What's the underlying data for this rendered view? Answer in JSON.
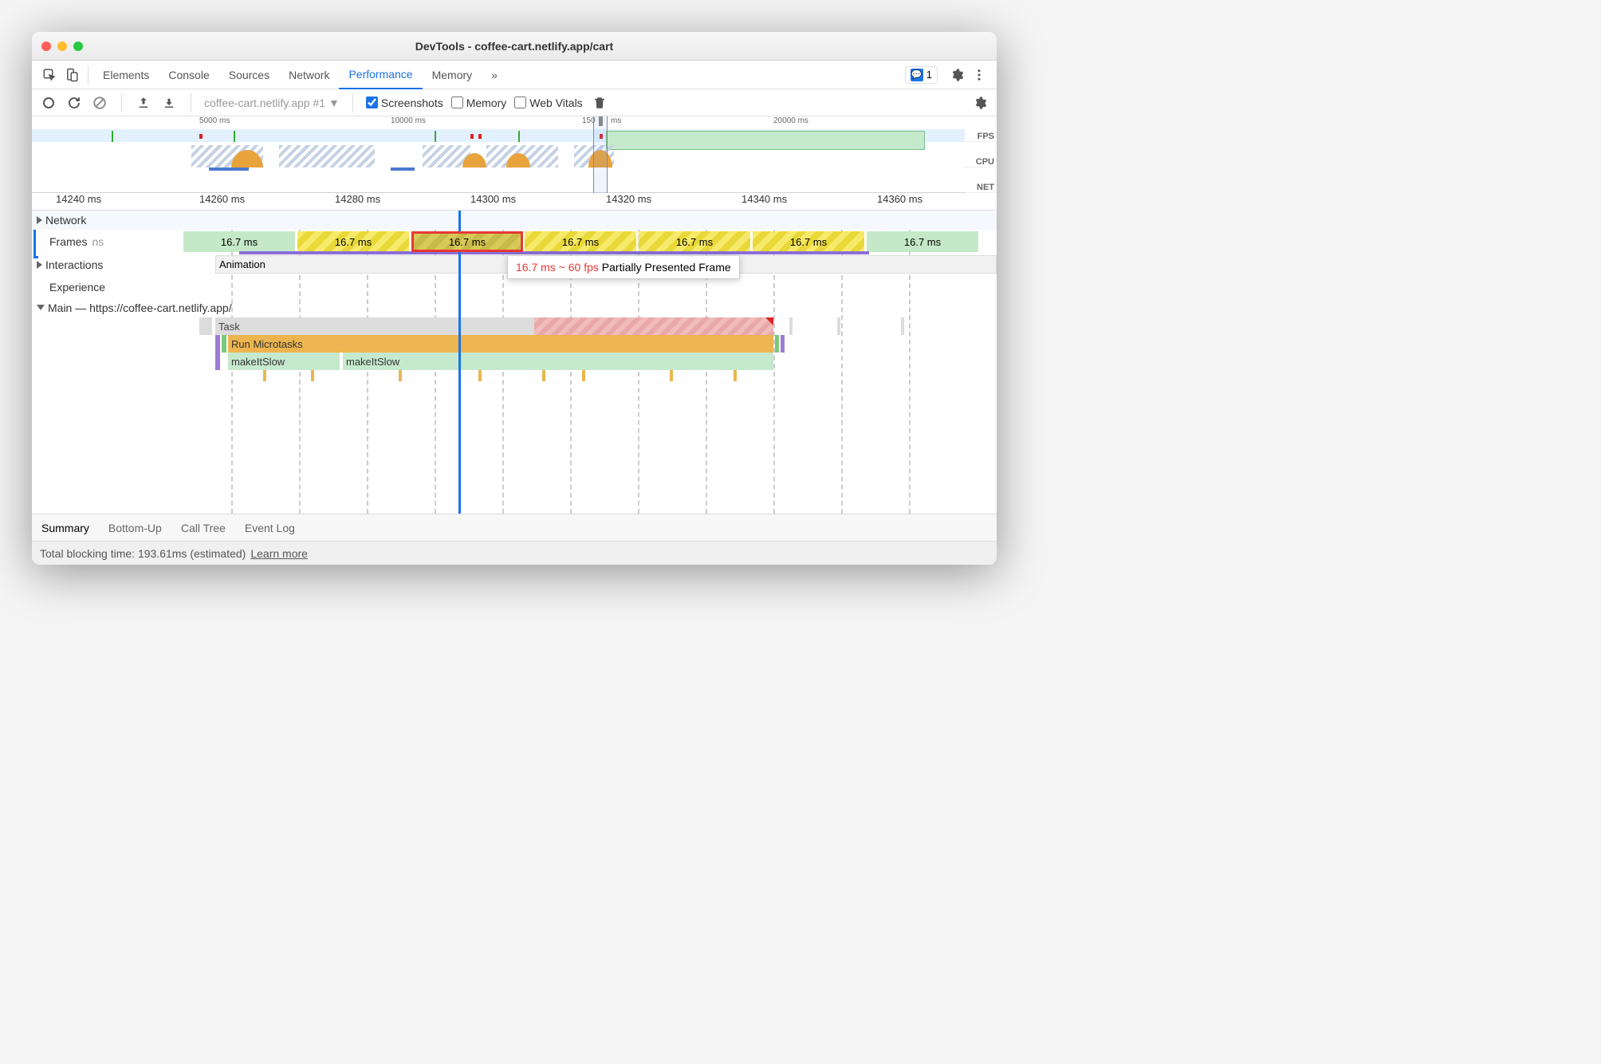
{
  "window": {
    "title": "DevTools - coffee-cart.netlify.app/cart"
  },
  "tabs": {
    "items": [
      "Elements",
      "Console",
      "Sources",
      "Network",
      "Performance",
      "Memory"
    ],
    "active": "Performance",
    "more": "»",
    "issues_count": "1"
  },
  "toolbar": {
    "recording_selector": "coffee-cart.netlify.app #1",
    "screenshots_label": "Screenshots",
    "memory_label": "Memory",
    "webvitals_label": "Web Vitals"
  },
  "overview": {
    "ticks": [
      "5000 ms",
      "10000 ms",
      "150",
      "ms",
      "20000 ms"
    ],
    "lane_labels": [
      "FPS",
      "CPU",
      "NET"
    ]
  },
  "ruler": {
    "ticks": [
      "14240 ms",
      "14260 ms",
      "14280 ms",
      "14300 ms",
      "14320 ms",
      "14340 ms",
      "14360 ms"
    ]
  },
  "tracks": {
    "network": "Network",
    "frames": "Frames",
    "frames_hint": "ns",
    "frame_values": [
      "16.7 ms",
      "16.7 ms",
      "16.7 ms",
      "16.7 ms",
      "16.7 ms",
      "16.7 ms",
      "16.7 ms"
    ],
    "interactions": "Interactions",
    "animation": "Animation",
    "experience": "Experience",
    "main": "Main — https://coffee-cart.netlify.app/",
    "flame": {
      "task": "Task",
      "microtasks": "Run Microtasks",
      "fn1": "makeItSlow",
      "fn2": "makeItSlow"
    }
  },
  "tooltip": {
    "timing": "16.7 ms ~ 60 fps",
    "label": "Partially Presented Frame"
  },
  "bottom_tabs": {
    "items": [
      "Summary",
      "Bottom-Up",
      "Call Tree",
      "Event Log"
    ],
    "active": "Summary"
  },
  "status": {
    "text": "Total blocking time: 193.61ms (estimated)",
    "learn": "Learn more"
  }
}
